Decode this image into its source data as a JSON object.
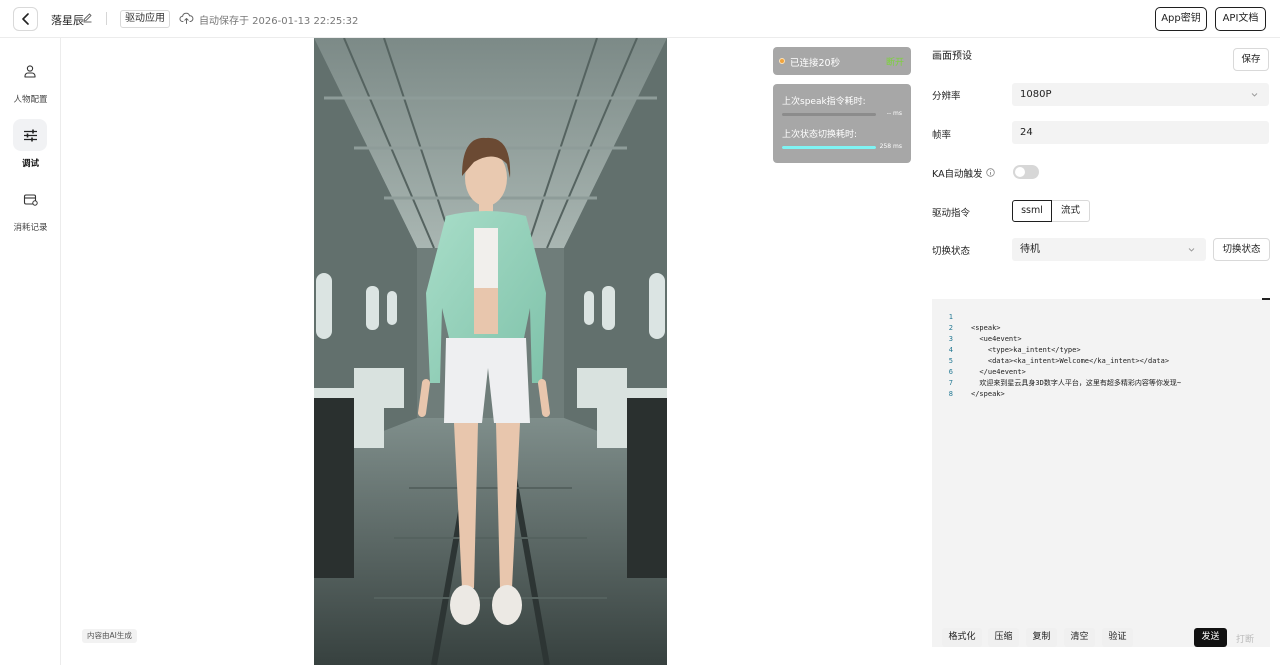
{
  "header": {
    "project_name": "落星辰",
    "app_tag": "驱动应用",
    "autosave": "自动保存于 2026-01-13 22:25:32",
    "app_key_label": "App密钥",
    "api_doc_label": "API文档"
  },
  "sidebar": {
    "items": [
      {
        "label": "人物配置",
        "icon": "person-icon",
        "active": false
      },
      {
        "label": "调试",
        "icon": "sliders-icon",
        "active": true
      },
      {
        "label": "消耗记录",
        "icon": "wallet-icon",
        "active": false
      }
    ]
  },
  "stage": {
    "ai_tag": "内容由AI生成",
    "status": {
      "connected_text": "已连接20秒",
      "disconnect_label": "断开",
      "colors": {
        "dot": "#f1a33c",
        "disconnect": "#7cd33a"
      }
    },
    "metrics": [
      {
        "label": "上次speak指令耗时:",
        "value": "-- ms",
        "fill": 0
      },
      {
        "label": "上次状态切换耗时:",
        "value": "258 ms",
        "fill": 1
      }
    ]
  },
  "panel": {
    "title": "画面预设",
    "save_label": "保存",
    "resolution": {
      "label": "分辨率",
      "value": "1080P"
    },
    "framerate": {
      "label": "帧率",
      "value": "24"
    },
    "ka_auto": {
      "label": "KA自动触发",
      "on": false
    },
    "drive_cmd": {
      "label": "驱动指令",
      "options": [
        "ssml",
        "流式"
      ],
      "selected": "ssml"
    },
    "switch_state": {
      "label": "切换状态",
      "value": "待机",
      "button_label": "切换状态"
    },
    "editor": {
      "line_numbers": [
        "1",
        "2",
        "3",
        "4",
        "5",
        "6",
        "7",
        "8"
      ],
      "lines": [
        "<speak>",
        "  <ue4event>",
        "    <type>ka_intent</type>",
        "    <data><ka_intent>Welcome</ka_intent></data>",
        "  </ue4event>",
        "  欢迎来到星云具身3D数字人平台，这里有超多精彩内容等你发现~",
        "</speak>",
        ""
      ]
    },
    "tools": [
      "格式化",
      "压缩",
      "复制",
      "清空",
      "验证"
    ],
    "send_label": "发送",
    "interrupt_label": "打断"
  }
}
